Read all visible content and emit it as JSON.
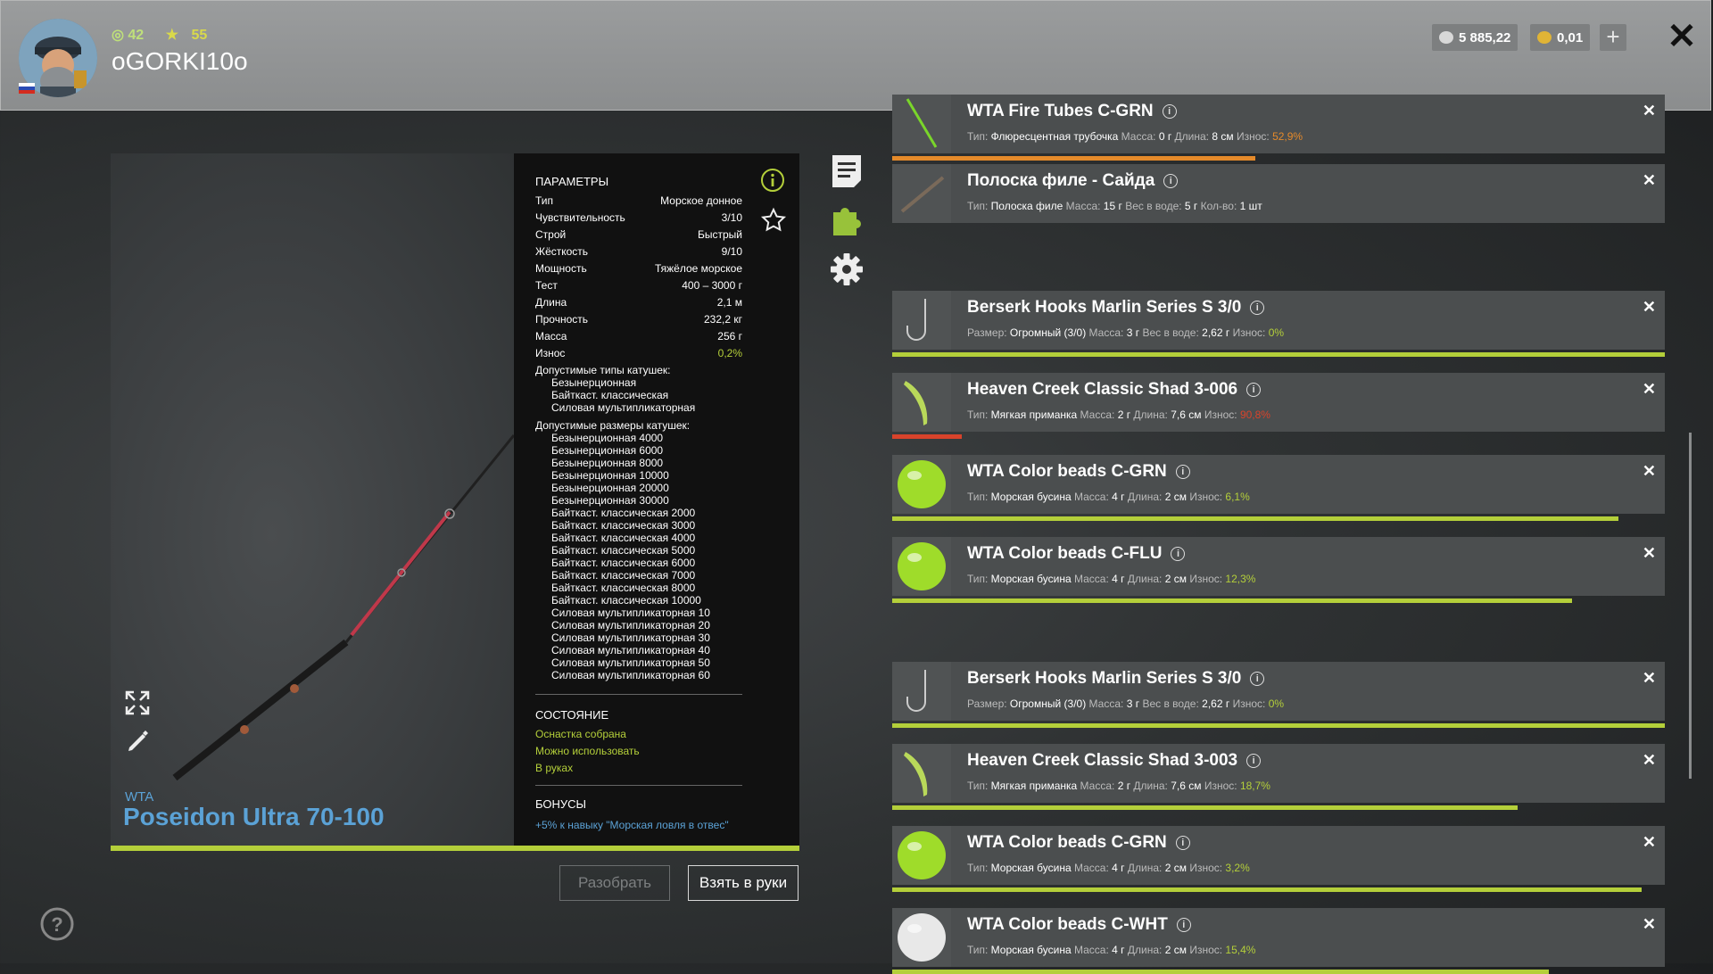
{
  "header": {
    "level": "42",
    "stars": "55",
    "username": "oGORKI10o",
    "silver": "5 885,22",
    "gold": "0,01",
    "plus": "+",
    "close": "✕"
  },
  "rod": {
    "brand": "WTA",
    "name": "Poseidon Ultra 70-100"
  },
  "params": {
    "title": "ПАРАМЕТРЫ",
    "rows": [
      {
        "label": "Тип",
        "value": "Морское донное"
      },
      {
        "label": "Чувствительность",
        "value": "3/10"
      },
      {
        "label": "Строй",
        "value": "Быстрый"
      },
      {
        "label": "Жёсткость",
        "value": "9/10"
      },
      {
        "label": "Мощность",
        "value": "Тяжёлое морское"
      },
      {
        "label": "Тест",
        "value": "400 – 3000 г"
      },
      {
        "label": "Длина",
        "value": "2,1 м"
      },
      {
        "label": "Прочность",
        "value": "232,2 кг"
      },
      {
        "label": "Масса",
        "value": "256 г"
      },
      {
        "label": "Износ",
        "value": "0,2%"
      }
    ],
    "reel_types_title": "Допустимые типы катушек:",
    "reel_types": [
      "Безынерционная",
      "Байткаст. классическая",
      "Силовая мультипликаторная"
    ],
    "reel_sizes_title": "Допустимые размеры катушек:",
    "reel_sizes": [
      "Безынерционная 4000",
      "Безынерционная 6000",
      "Безынерционная 8000",
      "Безынерционная 10000",
      "Безынерционная 20000",
      "Безынерционная 30000",
      "Байткаст. классическая 2000",
      "Байткаст. классическая 3000",
      "Байткаст. классическая 4000",
      "Байткаст. классическая 5000",
      "Байткаст. классическая 6000",
      "Байткаст. классическая 7000",
      "Байткаст. классическая 8000",
      "Байткаст. классическая 10000",
      "Силовая мультипликаторная 10",
      "Силовая мультипликаторная 20",
      "Силовая мультипликаторная 30",
      "Силовая мультипликаторная 40",
      "Силовая мультипликаторная 50",
      "Силовая мультипликаторная 60"
    ],
    "state_title": "СОСТОЯНИЕ",
    "states": [
      "Оснастка собрана",
      "Можно использовать",
      "В руках"
    ],
    "bonus_title": "БОНУСЫ",
    "bonus_text": "+5% к навыку \"Морская ловля в отвес\""
  },
  "buttons": {
    "disassemble": "Разобрать",
    "take": "Взять в руки"
  },
  "items": [
    {
      "name": "WTA Fire Tubes C-GRN",
      "details": [
        [
          "Тип:",
          "Флюресцентная трубочка"
        ],
        [
          "Масса:",
          "0 г"
        ],
        [
          "Длина:",
          "8 см"
        ]
      ],
      "wear_label": "Износ:",
      "wear": "52,9%",
      "wear_level": 0.47,
      "color": "#e58a2a"
    },
    {
      "name": "Полоска филе - Сайда",
      "details": [
        [
          "Тип:",
          "Полоска филе"
        ],
        [
          "Масса:",
          "15 г"
        ],
        [
          "Вес в воде:",
          "5 г"
        ],
        [
          "Кол-во:",
          "1 шт"
        ]
      ],
      "wear_label": "",
      "wear": "",
      "wear_level": 0,
      "color": "#b4cf3a"
    },
    {
      "name": "Berserk Hooks Marlin Series S 3/0",
      "details": [
        [
          "Размер:",
          "Огромный (3/0)"
        ],
        [
          "Масса:",
          "3 г"
        ],
        [
          "Вес в воде:",
          "2,62 г"
        ]
      ],
      "wear_label": "Износ:",
      "wear": "0%",
      "wear_level": 1.0,
      "color": "#b4cf3a"
    },
    {
      "name": "Heaven Creek Classic Shad 3-006",
      "details": [
        [
          "Тип:",
          "Мягкая приманка"
        ],
        [
          "Масса:",
          "2 г"
        ],
        [
          "Длина:",
          "7,6 см"
        ]
      ],
      "wear_label": "Износ:",
      "wear": "90,8%",
      "wear_level": 0.09,
      "color": "#d8432b"
    },
    {
      "name": "WTA Color beads C-GRN",
      "details": [
        [
          "Тип:",
          "Морская бусина"
        ],
        [
          "Масса:",
          "4 г"
        ],
        [
          "Длина:",
          "2 см"
        ]
      ],
      "wear_label": "Износ:",
      "wear": "6,1%",
      "wear_level": 0.94,
      "color": "#b4cf3a"
    },
    {
      "name": "WTA Color beads C-FLU",
      "details": [
        [
          "Тип:",
          "Морская бусина"
        ],
        [
          "Масса:",
          "4 г"
        ],
        [
          "Длина:",
          "2 см"
        ]
      ],
      "wear_label": "Износ:",
      "wear": "12,3%",
      "wear_level": 0.88,
      "color": "#b4cf3a"
    },
    {
      "name": "Berserk Hooks Marlin Series S 3/0",
      "details": [
        [
          "Размер:",
          "Огромный (3/0)"
        ],
        [
          "Масса:",
          "3 г"
        ],
        [
          "Вес в воде:",
          "2,62 г"
        ]
      ],
      "wear_label": "Износ:",
      "wear": "0%",
      "wear_level": 1.0,
      "color": "#b4cf3a"
    },
    {
      "name": "Heaven Creek Classic Shad 3-003",
      "details": [
        [
          "Тип:",
          "Мягкая приманка"
        ],
        [
          "Масса:",
          "2 г"
        ],
        [
          "Длина:",
          "7,6 см"
        ]
      ],
      "wear_label": "Износ:",
      "wear": "18,7%",
      "wear_level": 0.81,
      "color": "#b4cf3a"
    },
    {
      "name": "WTA Color beads C-GRN",
      "details": [
        [
          "Тип:",
          "Морская бусина"
        ],
        [
          "Масса:",
          "4 г"
        ],
        [
          "Длина:",
          "2 см"
        ]
      ],
      "wear_label": "Износ:",
      "wear": "3,2%",
      "wear_level": 0.97,
      "color": "#b4cf3a"
    },
    {
      "name": "WTA Color beads C-WHT",
      "details": [
        [
          "Тип:",
          "Морская бусина"
        ],
        [
          "Масса:",
          "4 г"
        ],
        [
          "Длина:",
          "2 см"
        ]
      ],
      "wear_label": "Износ:",
      "wear": "15,4%",
      "wear_level": 0.85,
      "color": "#b4cf3a"
    }
  ],
  "icons": {
    "info": "info-icon",
    "star": "star-icon",
    "notes": "notes-icon",
    "puzzle": "puzzle-icon",
    "gear": "gear-icon",
    "expand": "expand-icon",
    "brush": "brush-icon",
    "help": "help-icon"
  },
  "colors": {
    "accent": "#b4cf3a",
    "blue": "#5ba2d6",
    "danger": "#d8432b",
    "warn": "#e58a2a"
  }
}
